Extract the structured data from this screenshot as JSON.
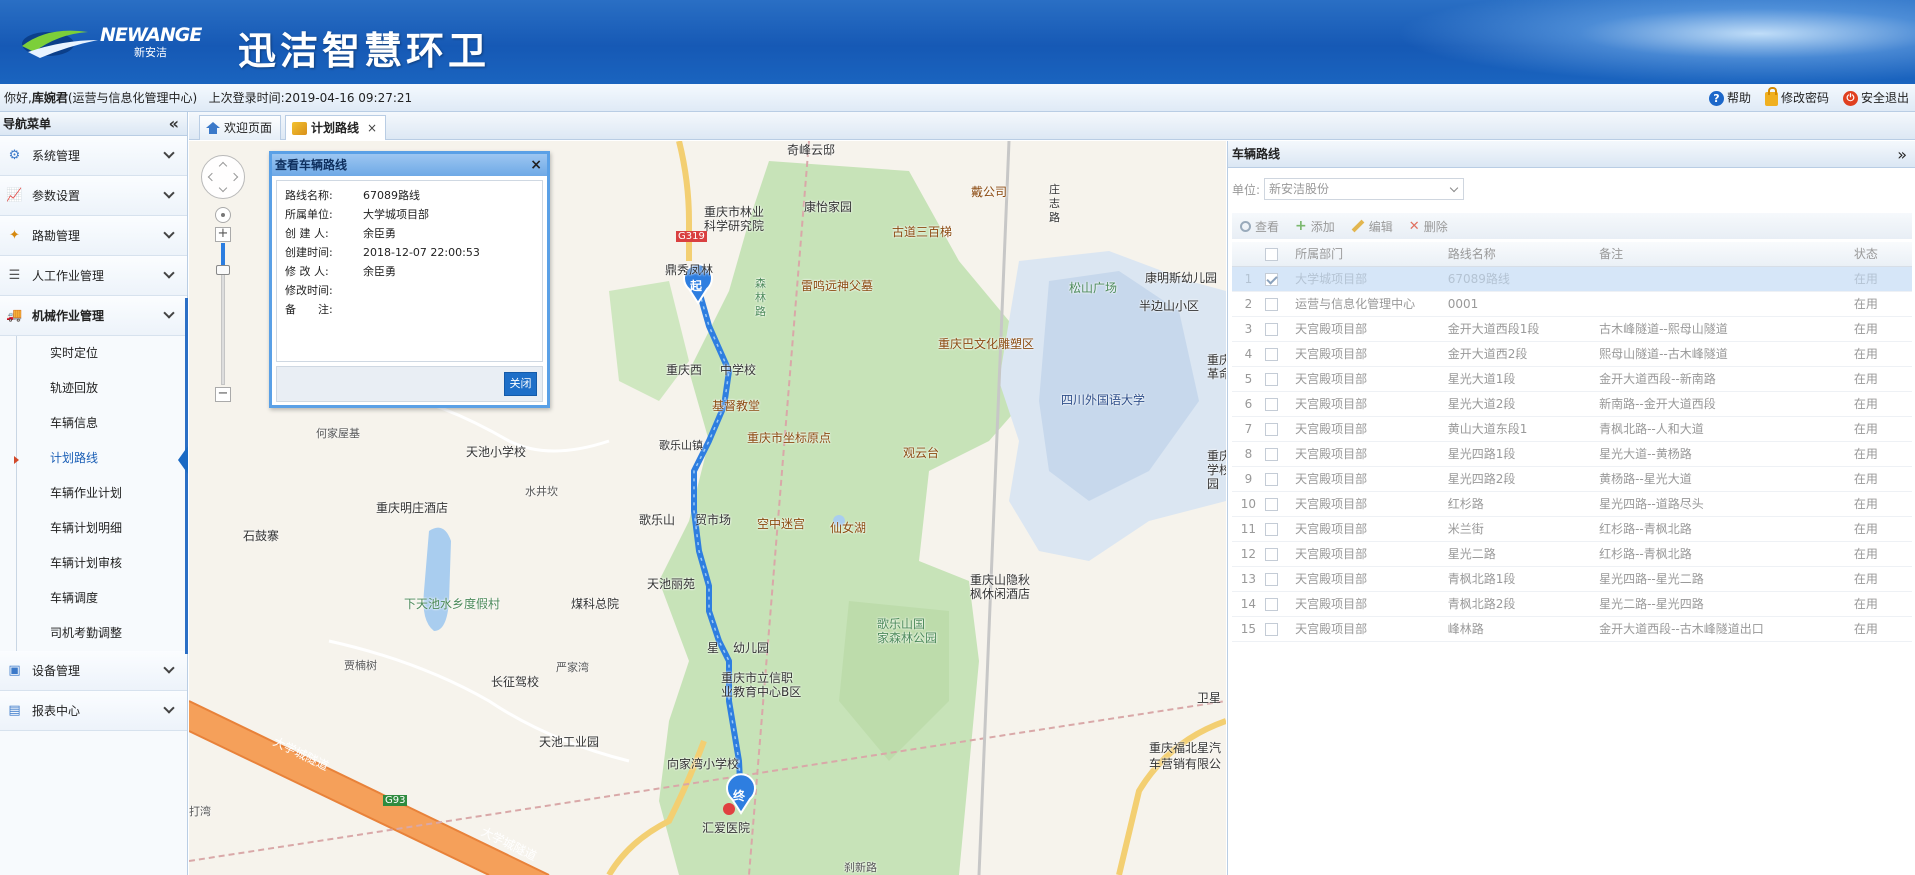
{
  "header": {
    "logo_en": "NEWANGE",
    "logo_cn": "新安洁",
    "title": "迅洁智慧环卫"
  },
  "infobar": {
    "greeting_prefix": "你好,",
    "user": "库婉君",
    "org": "(运营与信息化管理中心)",
    "last_login_label": "上次登录时间:",
    "last_login": "2019-04-16 09:27:21",
    "help": "帮助",
    "change_password": "修改密码",
    "logout": "安全退出"
  },
  "sidebar": {
    "title": "导航菜单",
    "collapse_glyph": "«",
    "menus": [
      {
        "label": "系统管理",
        "icon": "gears-icon"
      },
      {
        "label": "参数设置",
        "icon": "chart-icon"
      },
      {
        "label": "路勘管理",
        "icon": "worker-icon"
      },
      {
        "label": "人工作业管理",
        "icon": "list-icon"
      },
      {
        "label": "机械作业管理",
        "icon": "truck-icon"
      }
    ],
    "submenu": [
      "实时定位",
      "轨迹回放",
      "车辆信息",
      "计划路线",
      "车辆作业计划",
      "车辆计划明细",
      "车辆计划审核",
      "车辆调度",
      "司机考勤调整"
    ],
    "menus_after": [
      {
        "label": "设备管理",
        "icon": "monitor-icon"
      },
      {
        "label": "报表中心",
        "icon": "table-icon"
      }
    ]
  },
  "tabs": [
    {
      "label": "欢迎页面"
    },
    {
      "label": "计划路线",
      "close": "×"
    }
  ],
  "map": {
    "zoom_in": "+",
    "zoom_out": "−",
    "labels": [
      "奇峰云邸",
      "重庆市林业",
      "科学研究院",
      "康怡家园",
      "古道三百梯",
      "戴公司",
      "庄",
      "志",
      "路",
      "鼎秀凤林",
      "雷鸣远神父墓",
      "森",
      "林",
      "路",
      "松山广场",
      "康明斯幼儿园",
      "半边山小区",
      "重庆巴文化雕塑区",
      "重庆西",
      "中学校",
      "基督教堂",
      "四川外国语大学",
      "何家屋基",
      "天池小学校",
      "歌乐山镇",
      "重庆市坐标原点",
      "观云台",
      "水井坎",
      "重庆明庄酒店",
      "石鼓寨",
      "歌乐山",
      "贸市场",
      "空中迷宫",
      "仙女湖",
      "天池丽苑",
      "下天池水乡度假村",
      "煤科总院",
      "重庆山隐秋",
      "枫休闲酒店",
      "歌乐山国",
      "家森林公园",
      "星",
      "幼儿园",
      "重庆市立信职",
      "业教育中心B区",
      "贾楠树",
      "严家湾",
      "长征驾校",
      "卫星",
      "天池工业园",
      "向家湾小学校",
      "重庆福北星汽",
      "车营销有限公",
      "汇爱医院",
      "大学城隧道",
      "大学城隧道",
      "G93",
      "G319",
      "打湾",
      "刹新路",
      "重庆",
      "革命",
      "重庆",
      "学校",
      "园"
    ],
    "start_marker": "起",
    "end_marker": "终"
  },
  "popup": {
    "title": "查看车辆路线",
    "close_x": "×",
    "fields": [
      {
        "k": "路线名称:",
        "v": "67089路线"
      },
      {
        "k": "所属单位:",
        "v": "大学城项目部"
      },
      {
        "k": "创 建 人:",
        "v": "余臣勇"
      },
      {
        "k": "创建时间:",
        "v": "2018-12-07 22:00:53"
      },
      {
        "k": "修 改 人:",
        "v": "余臣勇"
      },
      {
        "k": "修改时间:",
        "v": ""
      },
      {
        "k": "备　　注:",
        "v": ""
      }
    ],
    "close_button": "关闭"
  },
  "rpanel": {
    "title": "车辆路线",
    "expand_glyph": "»",
    "unit_label": "单位:",
    "unit_value": "新安洁股份",
    "toolbar": {
      "search": "查看",
      "add": "添加",
      "edit": "编辑",
      "delete": "删除"
    },
    "columns": [
      "所属部门",
      "路线名称",
      "备注",
      "状态"
    ],
    "rows": [
      [
        "1",
        "大学城项目部",
        "67089路线",
        "",
        "在用"
      ],
      [
        "2",
        "运营与信息化管理中心",
        "0001",
        "",
        "在用"
      ],
      [
        "3",
        "天宫殿项目部",
        "金开大道西段1段",
        "古木峰隧道--熙母山隧道",
        "在用"
      ],
      [
        "4",
        "天宫殿项目部",
        "金开大道西2段",
        "熙母山隧道--古木峰隧道",
        "在用"
      ],
      [
        "5",
        "天宫殿项目部",
        "星光大道1段",
        "金开大道西段--新南路",
        "在用"
      ],
      [
        "6",
        "天宫殿项目部",
        "星光大道2段",
        "新南路--金开大道西段",
        "在用"
      ],
      [
        "7",
        "天宫殿项目部",
        "黄山大道东段1",
        "青枫北路--人和大道",
        "在用"
      ],
      [
        "8",
        "天宫殿项目部",
        "星光四路1段",
        "星光大道--黄杨路",
        "在用"
      ],
      [
        "9",
        "天宫殿项目部",
        "星光四路2段",
        "黄杨路--星光大道",
        "在用"
      ],
      [
        "10",
        "天宫殿项目部",
        "红杉路",
        "星光四路--道路尽头",
        "在用"
      ],
      [
        "11",
        "天宫殿项目部",
        "米兰街",
        "红杉路--青枫北路",
        "在用"
      ],
      [
        "12",
        "天宫殿项目部",
        "星光二路",
        "红杉路--青枫北路",
        "在用"
      ],
      [
        "13",
        "天宫殿项目部",
        "青枫北路1段",
        "星光四路--星光二路",
        "在用"
      ],
      [
        "14",
        "天宫殿项目部",
        "青枫北路2段",
        "星光二路--星光四路",
        "在用"
      ],
      [
        "15",
        "天宫殿项目部",
        "峰林路",
        "金开大道西段--古木峰隧道出口",
        "在用"
      ]
    ]
  }
}
